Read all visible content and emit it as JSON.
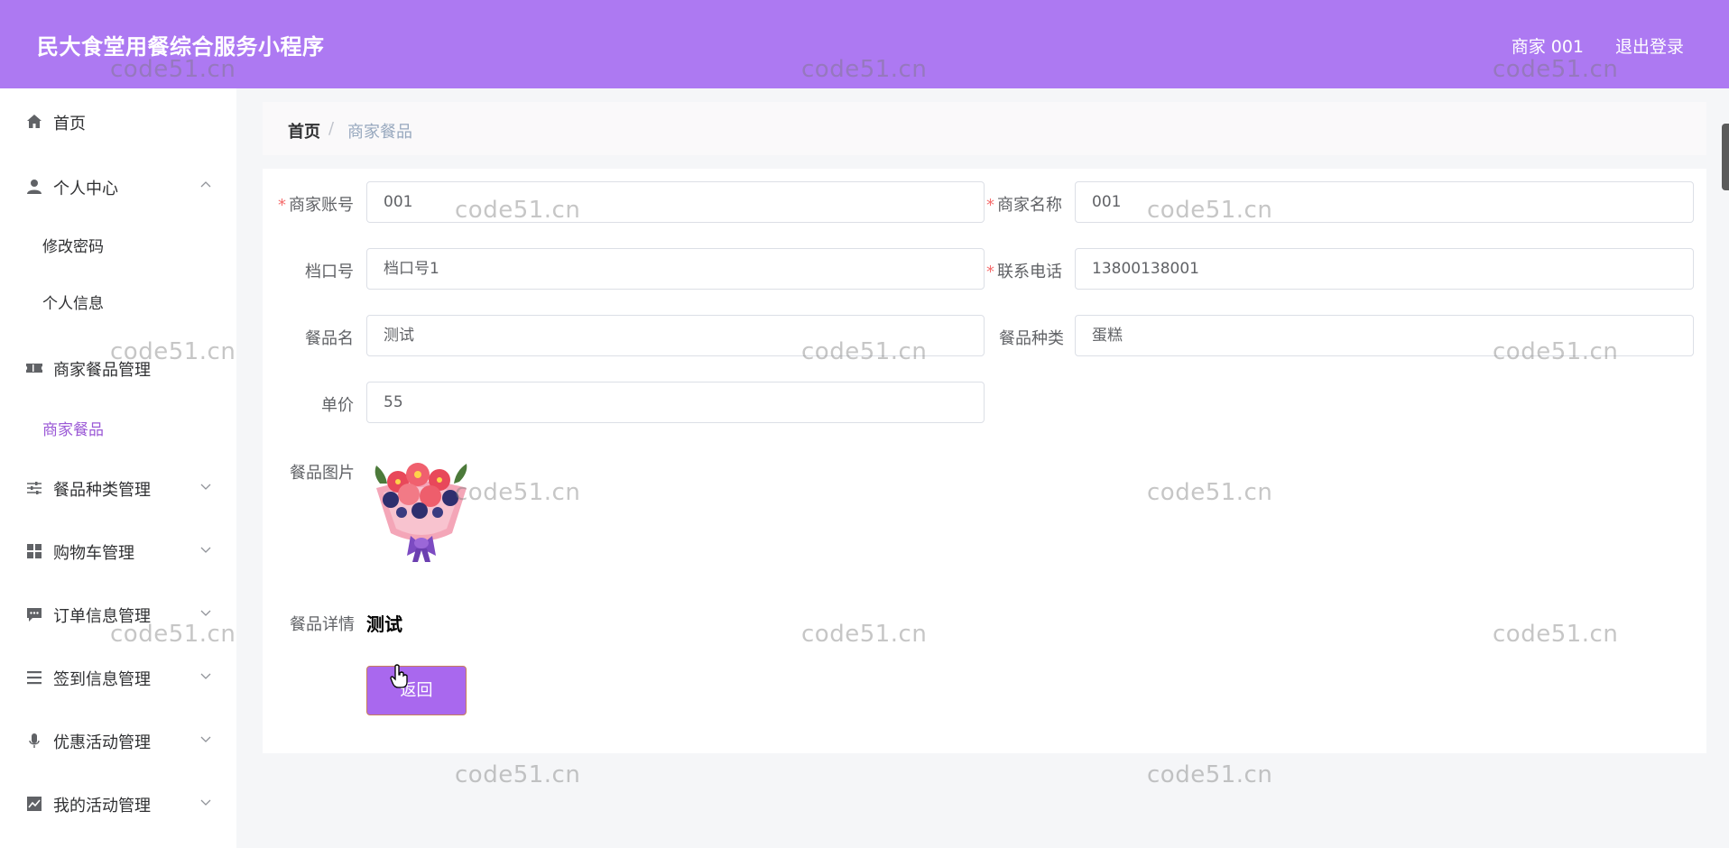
{
  "header": {
    "app_title": "民大食堂用餐综合服务小程序",
    "user_name": "商家 001",
    "logout_label": "退出登录",
    "bg_color": "#ad79f2"
  },
  "sidebar": {
    "home": {
      "label": "首页",
      "icon": "home-icon"
    },
    "personal_center": {
      "label": "个人中心",
      "icon": "user-icon",
      "expanded": true
    },
    "change_password": {
      "label": "修改密码"
    },
    "personal_info": {
      "label": "个人信息"
    },
    "merchant_food_mgmt": {
      "label": "商家餐品管理",
      "icon": "ticket-icon",
      "expanded": true
    },
    "merchant_food": {
      "label": "商家餐品",
      "active": true
    },
    "food_category_mgmt": {
      "label": "餐品种类管理",
      "icon": "sliders-icon"
    },
    "cart_mgmt": {
      "label": "购物车管理",
      "icon": "grid-icon"
    },
    "order_mgmt": {
      "label": "订单信息管理",
      "icon": "message-icon"
    },
    "signin_mgmt": {
      "label": "签到信息管理",
      "icon": "list-icon"
    },
    "promo_mgmt": {
      "label": "优惠活动管理",
      "icon": "microphone-icon"
    },
    "my_activity_mgmt": {
      "label": "我的活动管理",
      "icon": "chart-icon"
    }
  },
  "breadcrumb": {
    "home": "首页",
    "separator": "/",
    "current": "商家餐品"
  },
  "form": {
    "merchant_account": {
      "label": "商家账号",
      "value": "001",
      "required": true
    },
    "merchant_name": {
      "label": "商家名称",
      "value": "001",
      "required": true
    },
    "stall_no": {
      "label": "档口号",
      "value": "档口号1"
    },
    "phone": {
      "label": "联系电话",
      "value": "13800138001",
      "required": true
    },
    "food_name": {
      "label": "餐品名",
      "value": "测试"
    },
    "food_category": {
      "label": "餐品种类",
      "value": "蛋糕"
    },
    "price": {
      "label": "单价",
      "value": "55"
    },
    "food_image": {
      "label": "餐品图片"
    },
    "food_detail": {
      "label": "餐品详情",
      "value": "测试"
    },
    "back_button": {
      "label": "返回"
    }
  },
  "accent_colors": {
    "primary": "#ad79f2",
    "active_text": "#9b59d6",
    "required": "#f56c6c"
  },
  "watermark_text": "code51.cn"
}
